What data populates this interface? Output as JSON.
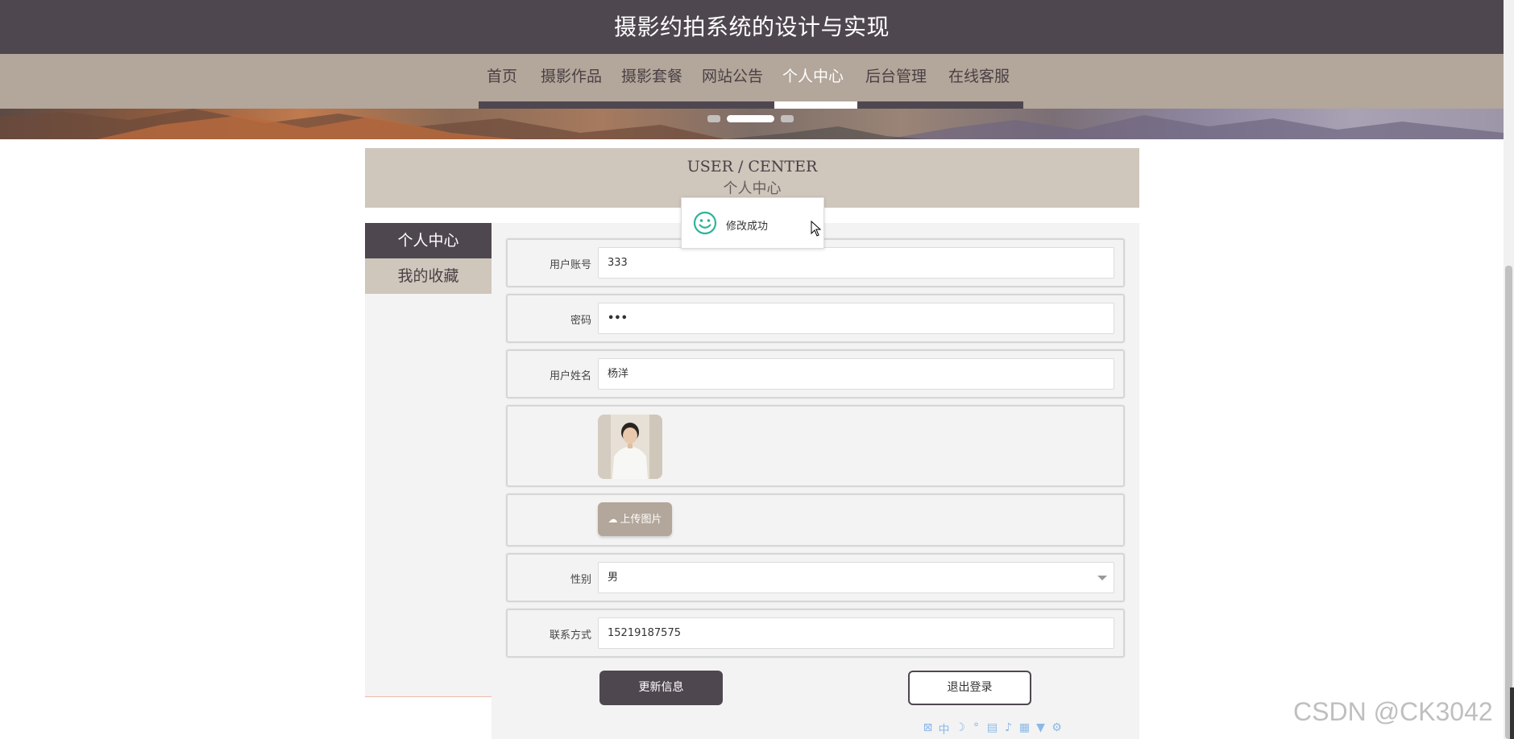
{
  "header": {
    "title": "摄影约拍系统的设计与实现"
  },
  "nav": {
    "items": [
      {
        "label": "首页",
        "active": false
      },
      {
        "label": "摄影作品",
        "active": false
      },
      {
        "label": "摄影套餐",
        "active": false
      },
      {
        "label": "网站公告",
        "active": false
      },
      {
        "label": "个人中心",
        "active": true
      },
      {
        "label": "后台管理",
        "active": false
      },
      {
        "label": "在线客服",
        "active": false
      }
    ]
  },
  "banner": {
    "slide_count": 3,
    "active_slide": 2
  },
  "section": {
    "title_en": "USER / CENTER",
    "title_zh": "个人中心"
  },
  "sidebar": {
    "items": [
      {
        "label": "个人中心",
        "active": true
      },
      {
        "label": "我的收藏",
        "active": false
      }
    ]
  },
  "form": {
    "account": {
      "label": "用户账号",
      "value": "333"
    },
    "password": {
      "label": "密码",
      "value": "•••"
    },
    "name": {
      "label": "用户姓名",
      "value": "杨洋"
    },
    "upload_label": "上传图片",
    "gender": {
      "label": "性别",
      "value": "男"
    },
    "phone": {
      "label": "联系方式",
      "value": "15219187575"
    },
    "update_button": "更新信息",
    "logout_button": "退出登录"
  },
  "toast": {
    "message": "修改成功"
  },
  "watermark": "CSDN @CK3042",
  "colors": {
    "primary": "#4f4750",
    "secondary": "#b3a69a",
    "light": "#cfc6bc",
    "success": "#2db49a"
  }
}
